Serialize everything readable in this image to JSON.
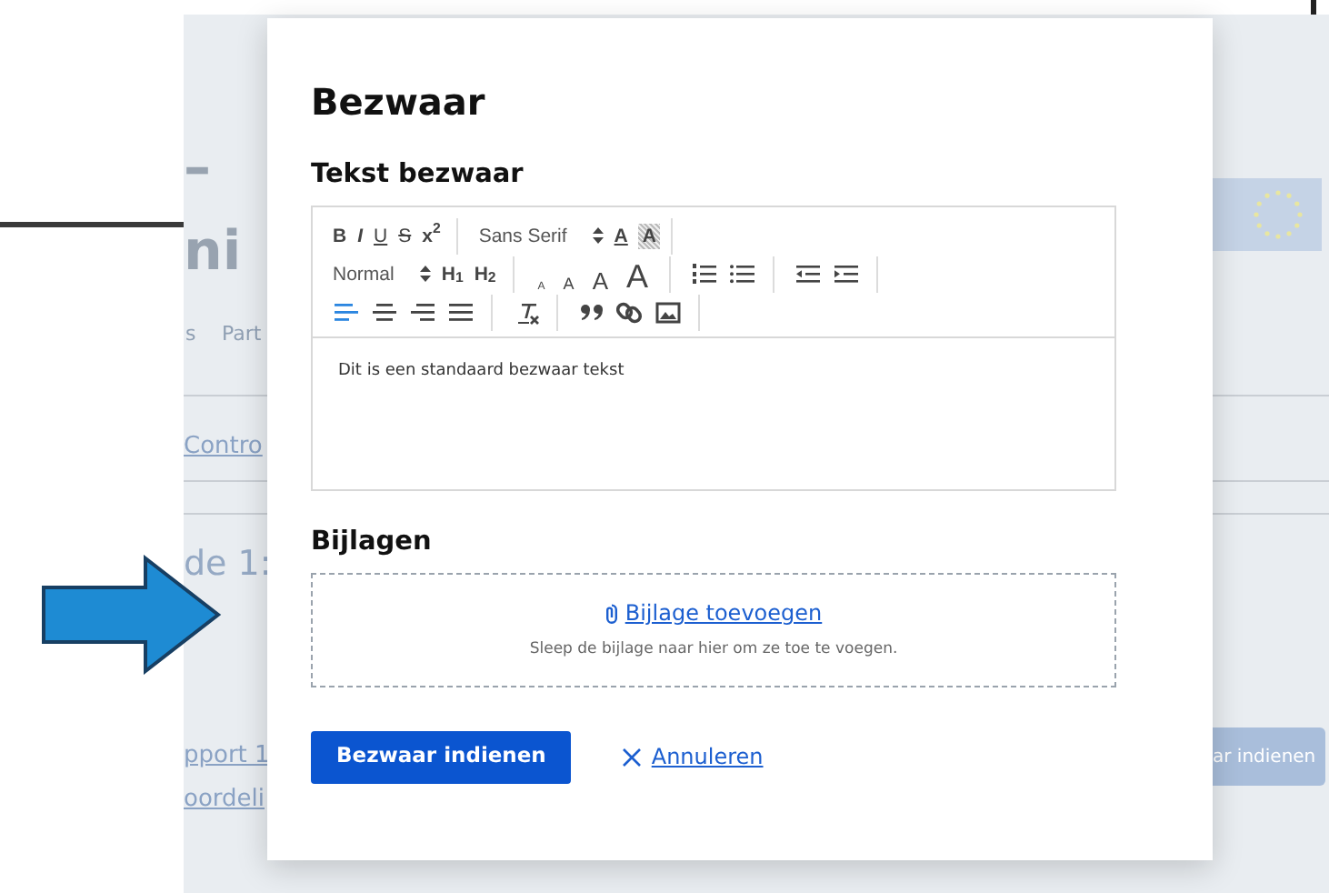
{
  "backdrop": {
    "texts": [
      {
        "text": "–",
        "kind": "heading"
      },
      {
        "text": "ni",
        "kind": "heading"
      },
      {
        "text": "s",
        "kind": "tab"
      },
      {
        "text": "Part",
        "kind": "tab"
      },
      {
        "text": "Contro",
        "kind": "link"
      },
      {
        "text": "de 1:",
        "kind": "section"
      },
      {
        "text": "pport 1",
        "kind": "link"
      },
      {
        "text": "oordeli",
        "kind": "link"
      }
    ],
    "button": "ar indienen"
  },
  "dialog": {
    "title": "Bezwaar",
    "editor": {
      "label": "Tekst bezwaar",
      "toolbar": [
        [
          [
            {
              "kind": "bold",
              "label": "B"
            },
            {
              "kind": "italic",
              "label": "I"
            },
            {
              "kind": "underline",
              "label": "U"
            },
            {
              "kind": "strike",
              "label": "S"
            },
            {
              "kind": "sup",
              "label": "x$^{2}$"
            }
          ],
          [
            {
              "kind": "picker",
              "label": "Sans Serif"
            },
            {
              "kind": "color",
              "label": "A"
            },
            {
              "kind": "background",
              "label": "A"
            }
          ]
        ],
        [
          [
            {
              "kind": "picker",
              "label": "Normal"
            },
            {
              "kind": "heading",
              "label": "H$_{1}$"
            },
            {
              "kind": "heading",
              "label": "H$_{2}$"
            }
          ],
          [
            {
              "kind": "small",
              "label": "A"
            },
            {
              "kind": "normal",
              "label": "A"
            },
            {
              "kind": "large",
              "label": "A"
            },
            {
              "kind": "huge",
              "label": "A"
            }
          ],
          [
            {
              "kind": "ordered"
            },
            {
              "kind": "bullet"
            }
          ],
          [
            {
              "kind": "outdent"
            },
            {
              "kind": "indent"
            }
          ]
        ],
        [
          [
            {
              "kind": "left",
              "selected": true
            },
            {
              "kind": "center",
              "selected": false
            },
            {
              "kind": "right",
              "selected": false
            },
            {
              "kind": "justify",
              "selected": false
            }
          ],
          [
            {
              "kind": "clean"
            }
          ],
          [
            {
              "kind": "quote"
            },
            {
              "kind": "link"
            },
            {
              "kind": "image"
            }
          ]
        ]
      ],
      "content": "Dit is een standaard bezwaar tekst"
    },
    "attachments": {
      "label": "Bijlagen",
      "link": "Bijlage toevoegen",
      "hint": "Sleep de bijlage naar hier om ze toe te voegen."
    },
    "buttons": [
      {
        "label": "Bezwaar indienen",
        "kind": "primary"
      },
      {
        "label": "Annuleren",
        "kind": "cancel"
      }
    ]
  }
}
